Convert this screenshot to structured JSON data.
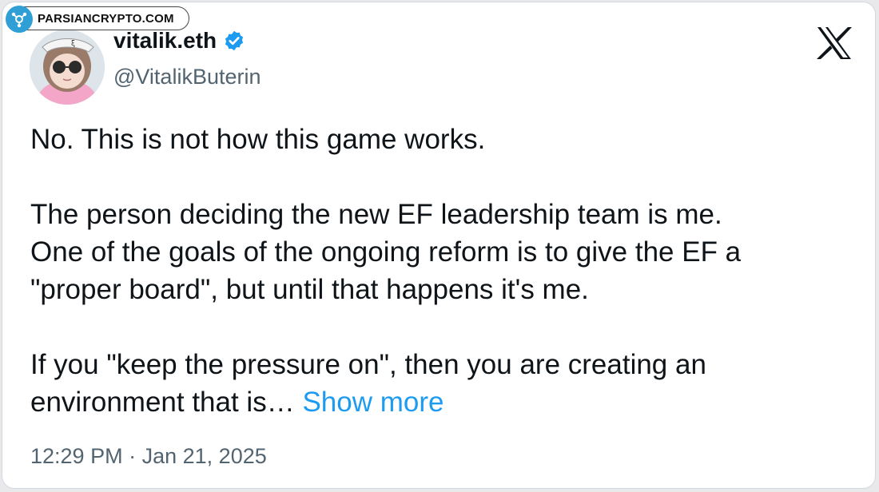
{
  "watermark": {
    "text": "PARSIANCRYPTO.COM"
  },
  "author": {
    "display_name": "vitalik.eth",
    "handle": "@VitalikButerin",
    "verified_color": "#1d9bf0",
    "avatar_icon": "avatar-cartoon"
  },
  "brand": {
    "icon": "x-logo-icon"
  },
  "tweet": {
    "paragraph1": "No. This is not how this game works.",
    "paragraph2_line1": "The person deciding the new EF leadership team is me.",
    "paragraph2_line2": "One of the goals of the ongoing reform is to give the EF a",
    "paragraph2_line3": "\"proper board\", but until that happens it's me.",
    "paragraph3_line1": "If you \"keep the pressure on\", then you are creating an",
    "paragraph3_line2": "environment that is…",
    "show_more": "Show more"
  },
  "meta": {
    "time": "12:29 PM",
    "separator": "·",
    "date": "Jan 21, 2025"
  }
}
